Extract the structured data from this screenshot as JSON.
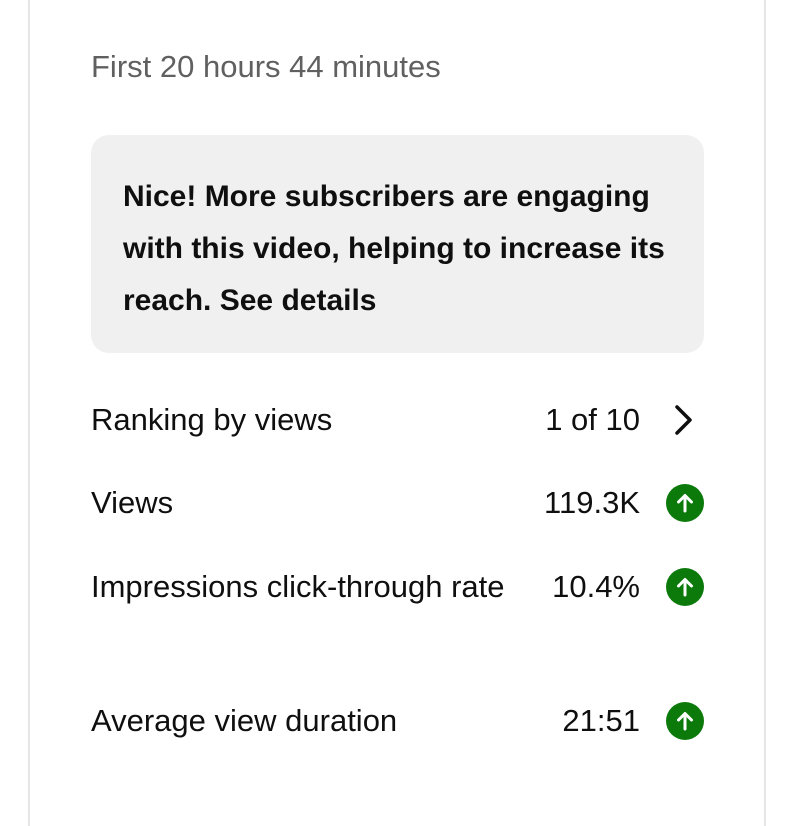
{
  "header": {
    "subtitle": "First 20 hours 44 minutes"
  },
  "insight": {
    "text": "Nice! More subscribers are engaging with this video, helping to increase its reach. See details"
  },
  "metrics": [
    {
      "label": "Ranking by views",
      "value": "1 of 10",
      "icon": "chevron-right-icon"
    },
    {
      "label": "Views",
      "value": "119.3K",
      "icon": "arrow-up-circle-icon"
    },
    {
      "label": "Impressions click-through rate",
      "value": "10.4%",
      "icon": "arrow-up-circle-icon"
    },
    {
      "label": "Average view duration",
      "value": "21:51",
      "icon": "arrow-up-circle-icon"
    }
  ],
  "colors": {
    "up_indicator": "#0b7a0b",
    "callout_background": "#f0f0f0",
    "subtitle_text": "#606060"
  }
}
